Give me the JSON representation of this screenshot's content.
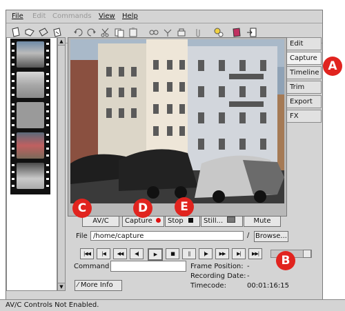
{
  "menu": [
    "File",
    "Edit",
    "Commands",
    "View",
    "Help"
  ],
  "toolbar_icons": [
    "new-icon",
    "open-icon",
    "save-icon",
    "export-icon",
    "undo-icon",
    "redo-icon",
    "cut-icon",
    "copy-icon",
    "paste-icon",
    "link-icon",
    "unlink-icon",
    "scissors-icon",
    "attach-icon",
    "light-icon",
    "book-icon",
    "exit-icon"
  ],
  "tabs": [
    "Edit",
    "Capture",
    "Timeline",
    "Trim",
    "Export",
    "FX"
  ],
  "controls": {
    "avc": "AV/C",
    "capture": "Capture",
    "stop": "Stop",
    "still": "Still...",
    "mute": "Mute"
  },
  "file": {
    "label": "File",
    "value": "/home/capture",
    "browse": "Browse..."
  },
  "transport": [
    "first-frame",
    "prev-scene",
    "rewind",
    "step-back",
    "play",
    "stop",
    "pause",
    "step-forward",
    "fast-forward",
    "next-scene",
    "last-frame"
  ],
  "info": {
    "command_label": "Command",
    "frame_position_label": "Frame Position:",
    "frame_position_value": "-",
    "recording_date_label": "Recording Date:",
    "recording_date_value": "-",
    "timecode_label": "Timecode:",
    "timecode_value": "00:01:16:15",
    "more_info": "More Info"
  },
  "status": "AV/C Controls Not Enabled.",
  "callouts": [
    "A",
    "B",
    "C",
    "D",
    "E"
  ],
  "colors": {
    "callout": "#e1241f",
    "record_dot": "#e01010"
  }
}
